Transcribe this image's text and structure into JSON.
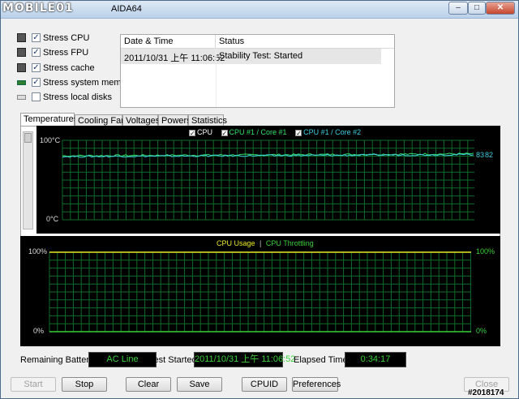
{
  "window": {
    "watermark_logo": "MOBILE01",
    "title": "AIDA64",
    "min_glyph": "–",
    "max_glyph": "□",
    "close_glyph": "✕"
  },
  "stress_options": [
    {
      "label": "Stress CPU",
      "checked": true,
      "icon": "cpu-icon"
    },
    {
      "label": "Stress FPU",
      "checked": true,
      "icon": "fpu-icon"
    },
    {
      "label": "Stress cache",
      "checked": true,
      "icon": "cache-icon"
    },
    {
      "label": "Stress system memory",
      "checked": true,
      "icon": "memory-icon"
    },
    {
      "label": "Stress local disks",
      "checked": false,
      "icon": "disk-icon"
    }
  ],
  "status_table": {
    "columns": [
      "Date & Time",
      "Status"
    ],
    "rows": [
      {
        "datetime": "2011/10/31 上午 11:06:52",
        "status": "Stability Test: Started"
      }
    ]
  },
  "tabs": [
    "Temperatures",
    "Cooling Fans",
    "Voltages",
    "Powers",
    "Statistics"
  ],
  "active_tab": "Temperatures",
  "temperature_graph": {
    "legend": [
      {
        "label": "CPU",
        "checked": true,
        "color": "#ffffff"
      },
      {
        "label": "CPU #1 / Core #1",
        "checked": true,
        "color": "#32e16b"
      },
      {
        "label": "CPU #1 / Core #2",
        "checked": true,
        "color": "#3ecfe0"
      }
    ],
    "y_max_label": "100°C",
    "y_min_label": "0°C",
    "value_label_1": "83",
    "value_label_2": "82",
    "y_max": 100,
    "y_min": 0,
    "series_levels": [
      83,
      82
    ],
    "grid_color": "#0f6e2a"
  },
  "usage_graph": {
    "legend_usage": "CPU Usage",
    "legend_sep": "|",
    "legend_throttling": "CPU Throttling",
    "usage_color": "#e9e929",
    "throttling_color": "#3bd13b",
    "left_max": "100%",
    "left_min": "0%",
    "right_max": "100%",
    "right_min": "0%",
    "grid_color": "#0f6e2a"
  },
  "info": {
    "battery_label": "Remaining Battery:",
    "battery_value": "AC Line",
    "started_label": "Test Started:",
    "started_value": "2011/10/31 上午 11:06:52",
    "elapsed_label": "Elapsed Time:",
    "elapsed_value": "0:34:17"
  },
  "buttons": {
    "start": "Start",
    "stop": "Stop",
    "clear": "Clear",
    "save": "Save",
    "cpuid": "CPUID",
    "preferences": "Preferences",
    "close": "Close"
  },
  "watermark": "#2018174"
}
